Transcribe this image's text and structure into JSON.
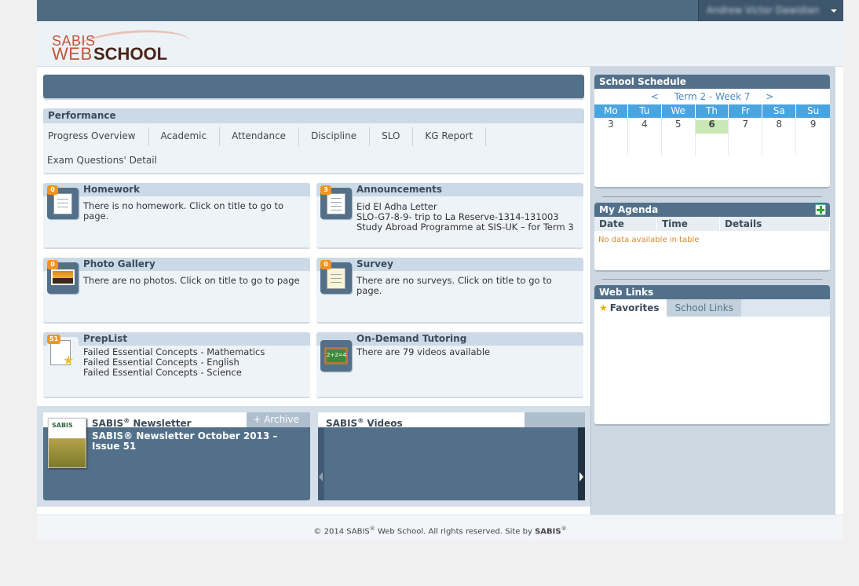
{
  "topbar": {
    "user_name": "Andrew Victor Dawidian"
  },
  "logo": {
    "line1": "SABIS",
    "line2a": "WEB",
    "line2b": "SCHOOL"
  },
  "performance": {
    "title": "Performance",
    "tabs": [
      "Progress Overview",
      "Academic",
      "Attendance",
      "Discipline",
      "SLO",
      "KG Report"
    ],
    "extra_link": "Exam Questions' Detail"
  },
  "cards": {
    "homework": {
      "title": "Homework",
      "badge": "0",
      "lines": [
        "There is no homework. Click on title to go to page."
      ]
    },
    "announcements": {
      "title": "Announcements",
      "badge": "3",
      "lines": [
        "Eid El Adha Letter",
        "SLO-G7-8-9- trip to La Reserve-1314-131003",
        "Study Abroad Programme at SIS-UK – for Term 3"
      ]
    },
    "photo": {
      "title": "Photo Gallery",
      "badge": "0",
      "lines": [
        "There are no photos. Click on title to go to page"
      ]
    },
    "survey": {
      "title": "Survey",
      "badge": "0",
      "lines": [
        "There are no surveys. Click on title to go to page."
      ]
    },
    "preplist": {
      "title": "PrepList",
      "badge": "51",
      "lines": [
        "Failed Essential Concepts - Mathematics",
        "Failed Essential Concepts - English",
        "Failed Essential Concepts - Science"
      ]
    },
    "tutoring": {
      "title": "On-Demand Tutoring",
      "board_text": "2+2=4",
      "lines": [
        "There are 79 videos available"
      ]
    }
  },
  "newsletter": {
    "title": "SABIS",
    "title_suffix": " Newsletter",
    "reg": "®",
    "archive_label": "+ Archive",
    "thumb_label": "SABIS",
    "headline": "SABIS® Newsletter October 2013 – Issue 51"
  },
  "videos": {
    "title": "SABIS",
    "title_suffix": " Videos",
    "reg": "®"
  },
  "schedule": {
    "title": "School Schedule",
    "prev": "<",
    "period": "Term 2 - Week 7",
    "next": ">",
    "days": [
      "Mo",
      "Tu",
      "We",
      "Th",
      "Fr",
      "Sa",
      "Su"
    ],
    "dates": [
      "3",
      "4",
      "5",
      "6",
      "7",
      "8",
      "9"
    ],
    "today_index": 3
  },
  "agenda": {
    "title": "My Agenda",
    "columns": [
      "Date",
      "Time",
      "Details"
    ],
    "empty": "No data available in table"
  },
  "weblinks": {
    "title": "Web Links",
    "tabs": [
      "Favorites",
      "School Links"
    ]
  },
  "footer": {
    "part1": "© 2014 SABIS",
    "reg": "®",
    "part2": " Web School. All rights reserved. Site by ",
    "brand": "SABIS",
    "reg2": "®"
  },
  "colors": {
    "header_blue": "#52708a",
    "badge_orange": "#f39422",
    "calendar_blue": "#4aa4e0",
    "today_green": "#c9e8b5"
  }
}
